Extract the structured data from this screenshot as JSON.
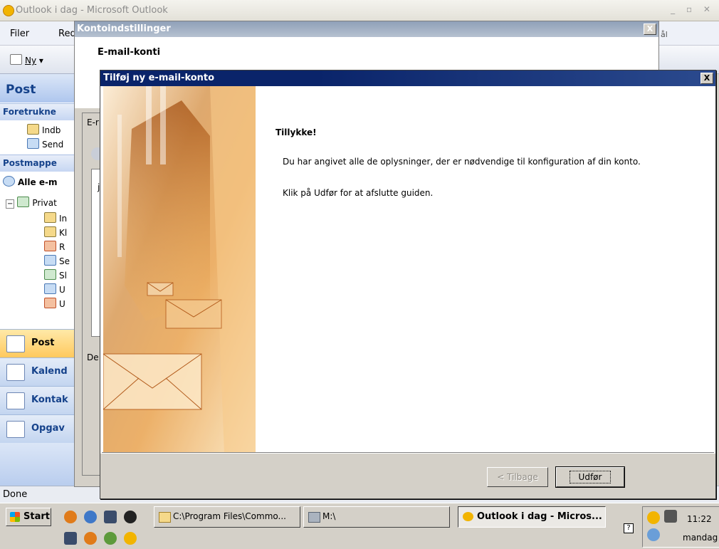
{
  "outlook": {
    "title": "Outlook i dag - Microsoft Outlook",
    "menu": {
      "file": "Filer",
      "edit_partial": "Red"
    },
    "toolbar": {
      "new": "Ny",
      "search_partial": "ål"
    },
    "nav": {
      "header": "Post",
      "favorites_label": "Foretrukne",
      "favorites": [
        "Indb",
        "Send"
      ],
      "mailfolders_label": "Postmappe",
      "all_mail": "Alle e-m",
      "tree_root": "Privat",
      "tree_items": [
        "In",
        "Kl",
        "R",
        "Se",
        "Sl",
        "U",
        "U"
      ]
    },
    "nav_buttons": [
      "Post",
      "Kalend",
      "Kontak",
      "Opgav"
    ],
    "status": "Done"
  },
  "konto": {
    "title": "Kontoindstillinger",
    "close": "X",
    "heading": "E-mail-konti",
    "behind_frag_1": "E-r",
    "behind_frag_2": "De",
    "behind_frag_3": "j"
  },
  "wizard": {
    "title": "Tilføj ny e-mail-konto",
    "close": "X",
    "heading": "Tillykke!",
    "line1": "Du har angivet alle de oplysninger, der er nødvendige til konfiguration af din konto.",
    "line2": "Klik på Udfør for at afslutte guiden.",
    "back_button": "< Tilbage",
    "finish_button": "Udfør"
  },
  "taskbar": {
    "start": "Start",
    "tasks": [
      "C:\\Program Files\\Commo...",
      "M:\\",
      "Outlook i dag - Micros..."
    ],
    "clock": "11:22",
    "day": "mandag"
  }
}
